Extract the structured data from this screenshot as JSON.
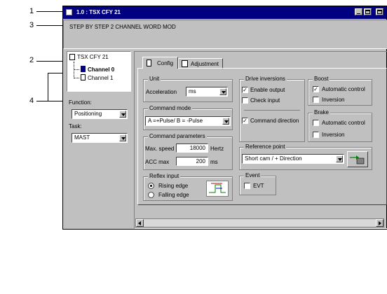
{
  "callouts": [
    "1",
    "3",
    "2",
    "4"
  ],
  "window": {
    "title": "1.0 : TSX CFY 21"
  },
  "header": {
    "text": "STEP BY STEP 2 CHANNEL WORD MOD"
  },
  "tree": {
    "module": "TSX CFY 21",
    "channels": [
      "Channel 0",
      "Channel 1"
    ]
  },
  "function": {
    "label": "Function:",
    "value": "Positioning"
  },
  "task": {
    "label": "Task:",
    "value": "MAST"
  },
  "tabs": [
    "Config",
    "Adjustment"
  ],
  "unit": {
    "title": "Unit",
    "acc_label": "Acceleration",
    "acc_value": "ms"
  },
  "command_mode": {
    "title": "Command mode",
    "value": "A =+Pulse/ B = -Pulse"
  },
  "command_params": {
    "title": "Command parameters",
    "speed_label": "Max. speed",
    "speed_value": "18000",
    "speed_unit": "Hertz",
    "acc_label": "ACC max",
    "acc_value": "200",
    "acc_unit": "ms"
  },
  "reflex": {
    "title": "Reflex input",
    "rising": "Rising edge",
    "falling": "Falling edge"
  },
  "drive": {
    "title": "Drive inversions",
    "enable": "Enable output",
    "check": "Check input",
    "direction": "Command direction",
    "enable_checked": "✓",
    "check_checked": "",
    "direction_checked": "✓"
  },
  "boost": {
    "title": "Boost",
    "auto": "Automatic control",
    "inversion": "Inversion",
    "auto_checked": "✓"
  },
  "brake": {
    "title": "Brake",
    "auto": "Automatic control",
    "inversion": "Inversion"
  },
  "reference": {
    "title": "Reference point",
    "value": "Short cam / + Direction"
  },
  "event": {
    "title": "Event",
    "evt": "EVT"
  }
}
